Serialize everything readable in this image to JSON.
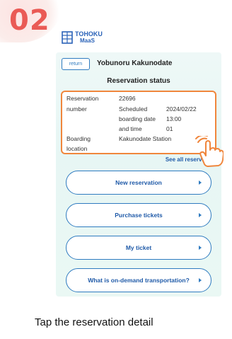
{
  "step": {
    "number": "02"
  },
  "logo": {
    "line1": "TOHOKU",
    "line2": "MaaS",
    "icon": "building-grid-icon"
  },
  "app": {
    "return_label": "return",
    "title": "Yobunoru Kakunodate",
    "section_title": "Reservation status"
  },
  "reservation": {
    "number_label_1": "Reservation",
    "number_label_2": "number",
    "number_value": "22696",
    "scheduled_label_1": "Scheduled",
    "scheduled_label_2": "boarding date",
    "scheduled_label_3": "and time",
    "date_value": "2024/02/22",
    "time_value": "13:00",
    "count_value": "01",
    "boarding_label_1": "Boarding",
    "boarding_label_2": "location",
    "location_value": "Kakunodate Station"
  },
  "links": {
    "see_all": "See all reservations"
  },
  "menu": [
    {
      "label": "New reservation"
    },
    {
      "label": "Purchase tickets"
    },
    {
      "label": "My ticket"
    },
    {
      "label": "What is on-demand transportation?"
    }
  ],
  "caption": "Tap the reservation detail",
  "colors": {
    "step": "#ea5a55",
    "highlight": "#f0863c",
    "brand_blue": "#2f7bc0",
    "phone_bg": "#e7f6f4"
  }
}
